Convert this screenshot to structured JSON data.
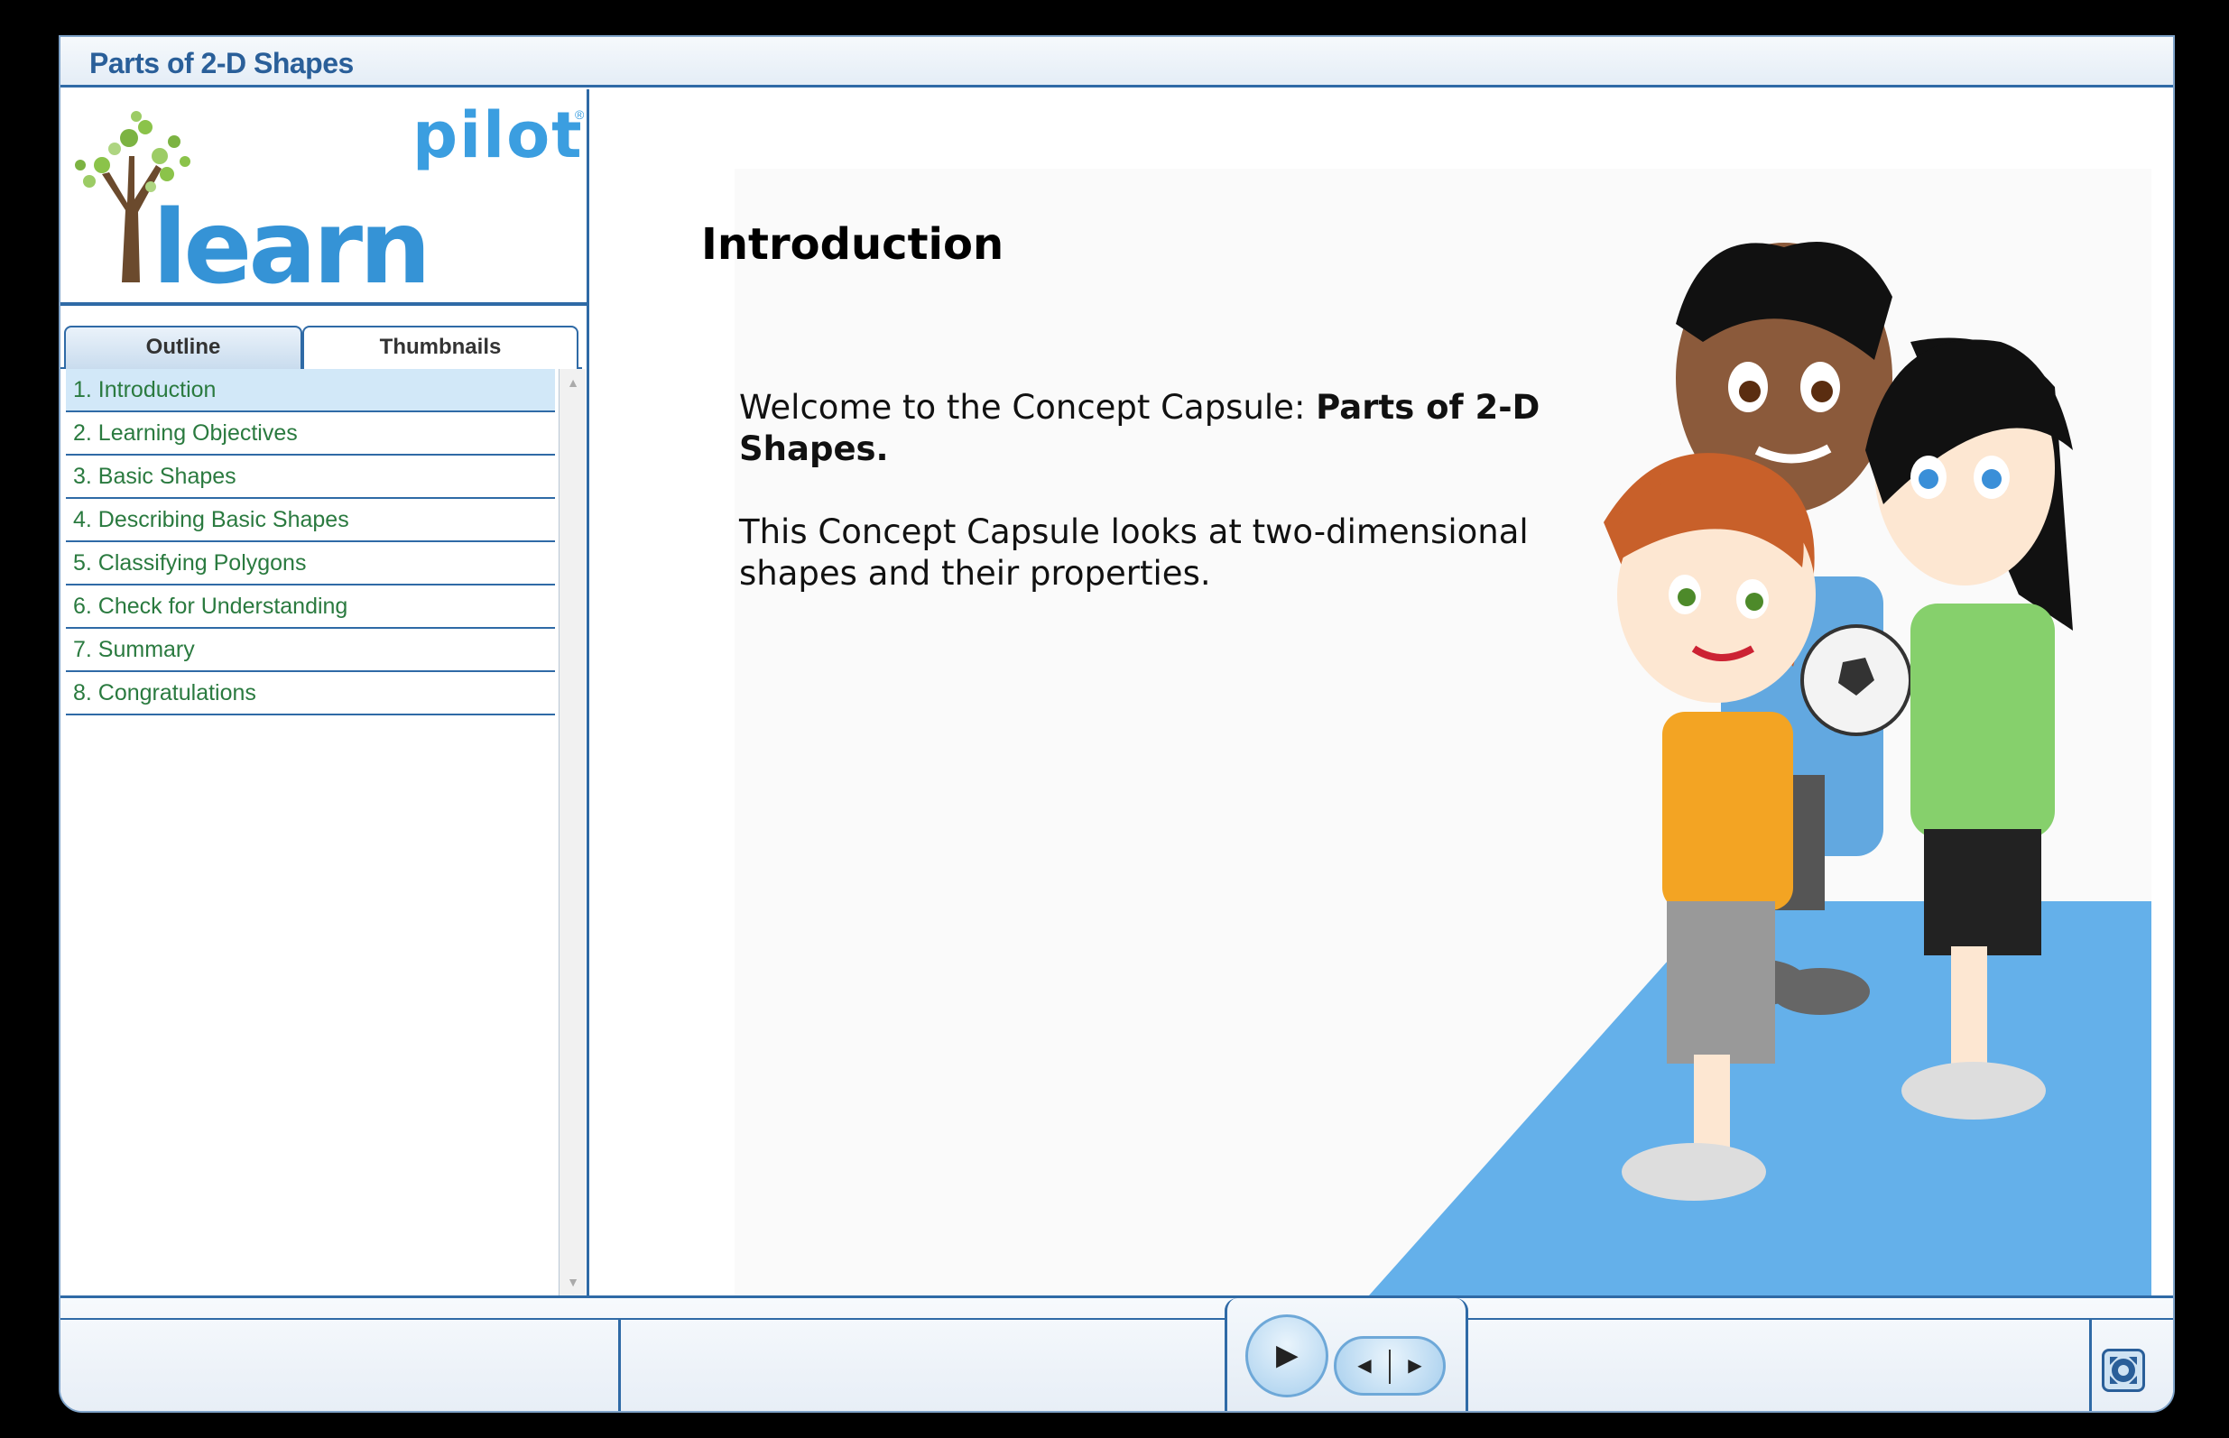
{
  "window": {
    "title": "Parts of 2-D Shapes"
  },
  "logo": {
    "pilot": "pilot",
    "learn": "learn",
    "registered": "®"
  },
  "tabs": {
    "outline": "Outline",
    "thumbnails": "Thumbnails"
  },
  "outline": [
    "1. Introduction",
    "2. Learning Objectives",
    "3. Basic Shapes",
    "4. Describing Basic Shapes",
    "5. Classifying Polygons",
    "6. Check for Understanding",
    "7. Summary",
    "8. Congratulations"
  ],
  "slide": {
    "title": "Introduction",
    "welcome_prefix": "Welcome to the Concept Capsule: ",
    "welcome_bold": "Parts of 2-D Shapes.",
    "body": "This Concept Capsule looks at two-dimensional shapes and their properties."
  },
  "controls": {
    "play": "▶",
    "step_back": "◀",
    "step_forward": "▶"
  },
  "icons": {
    "play": "play-icon",
    "step_back": "step-back-icon",
    "step_forward": "step-forward-icon",
    "fullscreen": "fullscreen-icon"
  },
  "colors": {
    "accent": "#2f6aa6",
    "title": "#2a5f99",
    "outline_text": "#2a7a3f",
    "active_row": "#d2e8f8",
    "floor": "#64b0ea"
  }
}
